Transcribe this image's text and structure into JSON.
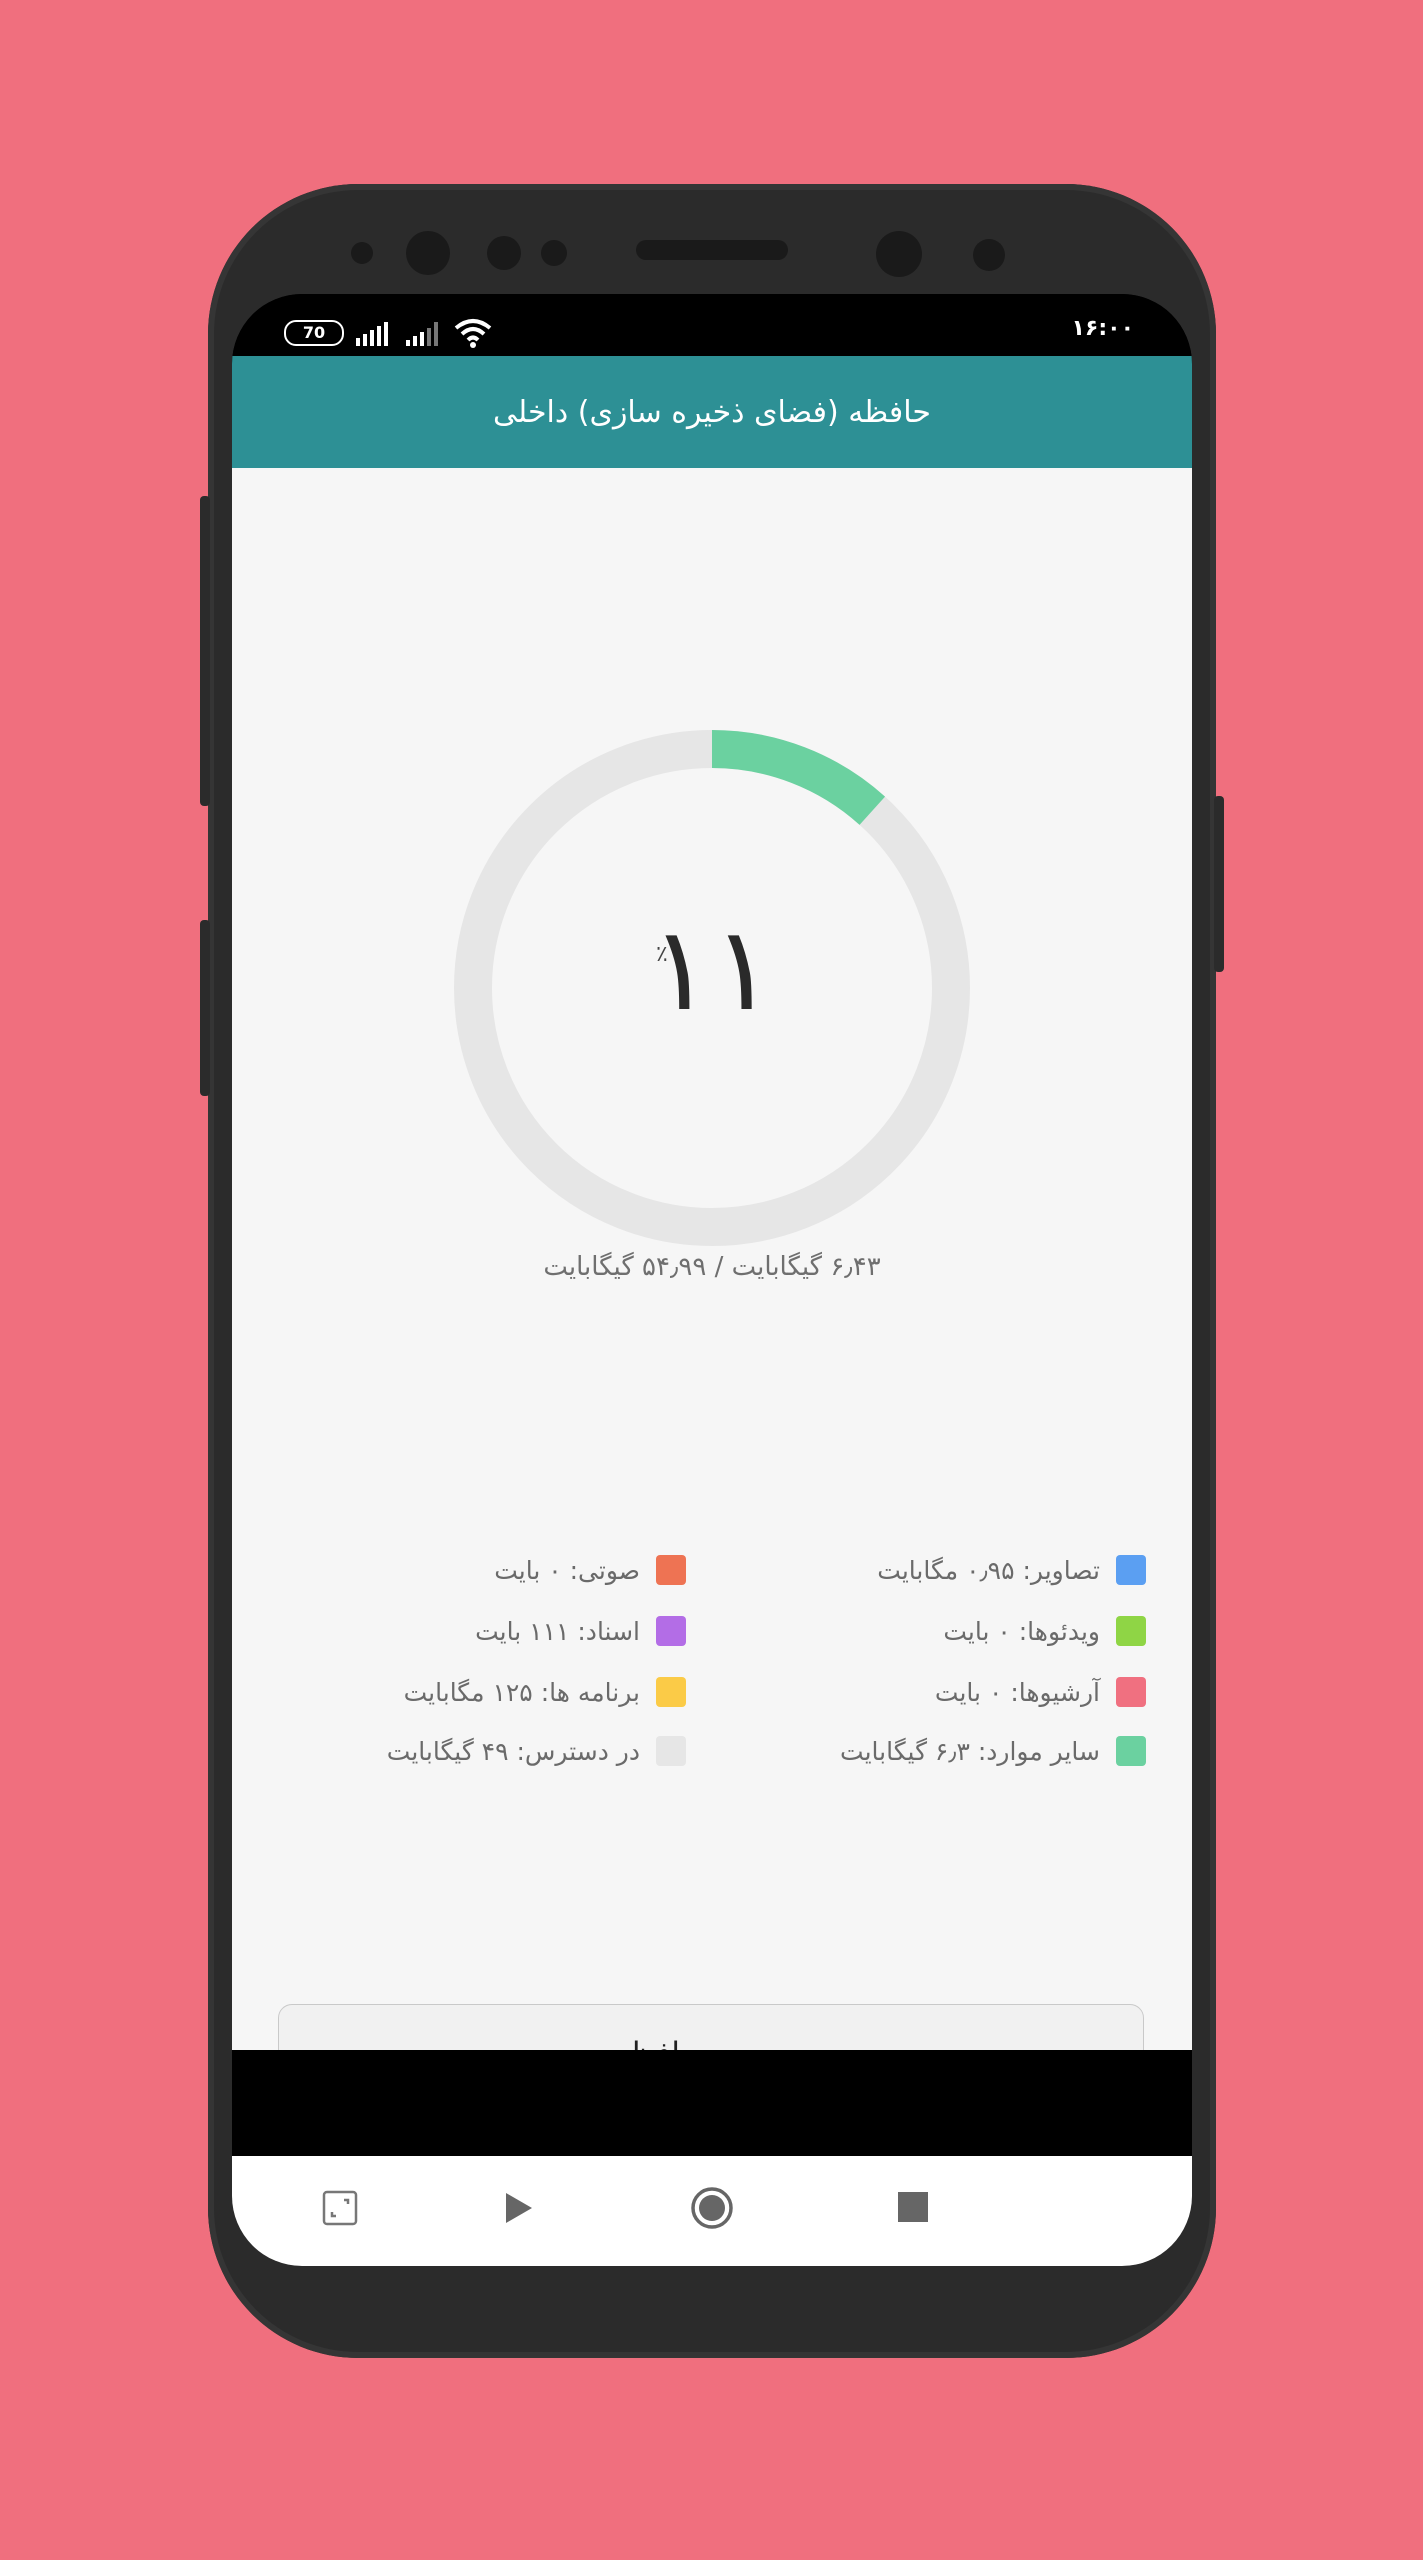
{
  "status_bar": {
    "battery": "70",
    "time": "۱۶:۰۰"
  },
  "app_bar": {
    "title": "حافظه (فضای ذخیره سازی) داخلی"
  },
  "storage": {
    "percent": "۱۱",
    "percent_sign": "٪",
    "used_fraction": 0.117,
    "usage_text": "۶٫۴۳ گیگابایت / ۵۴٫۹۹ گیگابایت",
    "ring_color": "#6bd1a0",
    "track_color": "#e6e6e6"
  },
  "legend": {
    "right_column": [
      {
        "label": "تصاویر: ۰٫۹۵ مگابایت",
        "color": "#5b9ff2"
      },
      {
        "label": "ویدئوها: ۰ بایت",
        "color": "#8fd545"
      },
      {
        "label": "آرشیوها: ۰ بایت",
        "color": "#f07080"
      },
      {
        "label": "سایر موارد: ۶٫۳ گیگابایت",
        "color": "#6bd1a0"
      }
    ],
    "left_column": [
      {
        "label": "صوتی: ۰ بایت",
        "color": "#ee7353"
      },
      {
        "label": "اسناد: ۱۱۱ بایت",
        "color": "#b36de6"
      },
      {
        "label": "برنامه ها: ۱۲۵ مگابایت",
        "color": "#fbcb47"
      },
      {
        "label": "در دسترس: ۴۹ گیگابایت",
        "color": "#e6e6e6"
      }
    ]
  },
  "actions": {
    "manage_label": "مدیریت حافظه"
  },
  "nav": {
    "icons": [
      "screenshot-icon",
      "play-icon",
      "home-icon",
      "recents-icon"
    ]
  }
}
